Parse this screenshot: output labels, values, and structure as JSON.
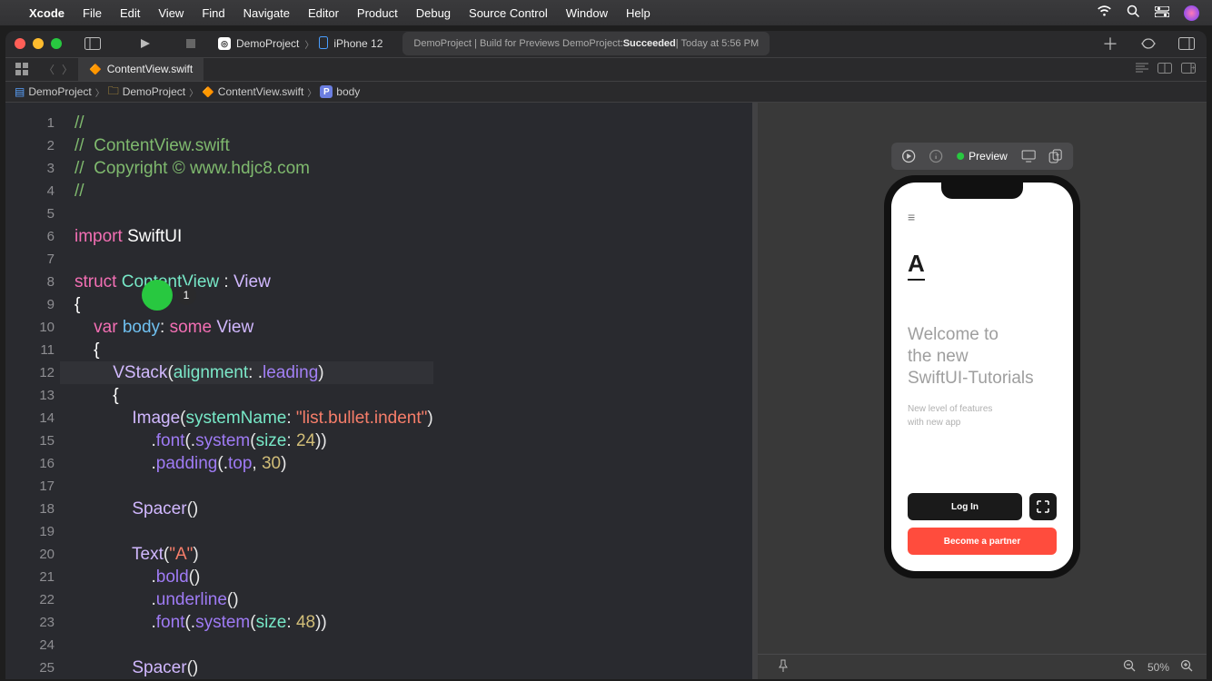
{
  "menubar": {
    "app": "Xcode",
    "items": [
      "File",
      "Edit",
      "View",
      "Find",
      "Navigate",
      "Editor",
      "Product",
      "Debug",
      "Source Control",
      "Window",
      "Help"
    ]
  },
  "toolbar": {
    "scheme_project": "DemoProject",
    "scheme_device": "iPhone 12",
    "build_prefix": "DemoProject | Build for Previews DemoProject: ",
    "build_status": "Succeeded",
    "build_time": " | Today at 5:56 PM"
  },
  "tabbar": {
    "open_tab": "ContentView.swift"
  },
  "pathbar": {
    "parts": [
      "DemoProject",
      "DemoProject",
      "ContentView.swift",
      "body"
    ]
  },
  "code": {
    "lines": [
      {
        "n": 1,
        "html": "<span class='tok-comment'>//</span>"
      },
      {
        "n": 2,
        "html": "<span class='tok-comment'>//  ContentView.swift</span>"
      },
      {
        "n": 3,
        "html": "<span class='tok-comment'>//  Copyright © www.hdjc8.com</span>"
      },
      {
        "n": 4,
        "html": "<span class='tok-comment'>//</span>"
      },
      {
        "n": 5,
        "html": ""
      },
      {
        "n": 6,
        "html": "<span class='tok-keyword'>import</span> <span class='tok-default'>SwiftUI</span>"
      },
      {
        "n": 7,
        "html": ""
      },
      {
        "n": 8,
        "html": "<span class='tok-keyword'>struct</span> <span class='tok-type'>ContentView</span> : <span class='tok-typeref'>View</span>"
      },
      {
        "n": 9,
        "html": "<span class='tok-default'>{</span>"
      },
      {
        "n": 10,
        "html": "    <span class='tok-keyword'>var</span> <span class='tok-ident'>body</span>: <span class='tok-keyword'>some</span> <span class='tok-typeref'>View</span>"
      },
      {
        "n": 11,
        "html": "    <span class='tok-default'>{</span>"
      },
      {
        "n": 12,
        "html": "        <span class='tok-typeref'>VStack</span>(<span class='tok-member'>alignment</span>: .<span class='tok-func'>leading</span>)"
      },
      {
        "n": 13,
        "html": "        <span class='tok-default'>{</span>"
      },
      {
        "n": 14,
        "html": "            <span class='tok-typeref'>Image</span>(<span class='tok-member'>systemName</span>: <span class='tok-string'>\"list.bullet.indent\"</span>)"
      },
      {
        "n": 15,
        "html": "                .<span class='tok-func'>font</span>(.<span class='tok-func'>system</span>(<span class='tok-member'>size</span>: <span class='tok-number'>24</span>))"
      },
      {
        "n": 16,
        "html": "                .<span class='tok-func'>padding</span>(.<span class='tok-func'>top</span>, <span class='tok-number'>30</span>)"
      },
      {
        "n": 17,
        "html": ""
      },
      {
        "n": 18,
        "html": "            <span class='tok-typeref'>Spacer</span>()"
      },
      {
        "n": 19,
        "html": ""
      },
      {
        "n": 20,
        "html": "            <span class='tok-typeref'>Text</span>(<span class='tok-string'>\"A\"</span>)"
      },
      {
        "n": 21,
        "html": "                .<span class='tok-func'>bold</span>()"
      },
      {
        "n": 22,
        "html": "                .<span class='tok-func'>underline</span>()"
      },
      {
        "n": 23,
        "html": "                .<span class='tok-func'>font</span>(.<span class='tok-func'>system</span>(<span class='tok-member'>size</span>: <span class='tok-number'>48</span>))"
      },
      {
        "n": 24,
        "html": ""
      },
      {
        "n": 25,
        "html": "            <span class='tok-typeref'>Spacer</span>()"
      }
    ],
    "highlight_line": 12,
    "badge_count": "1"
  },
  "preview": {
    "label": "Preview",
    "zoom": "50%",
    "phone": {
      "bigA": "A",
      "headline1": "Welcome to",
      "headline2": "the new",
      "headline3": "SwiftUI-Tutorials",
      "sub1": "New level of features",
      "sub2": "with new app",
      "login": "Log In",
      "partner": "Become a partner"
    }
  }
}
